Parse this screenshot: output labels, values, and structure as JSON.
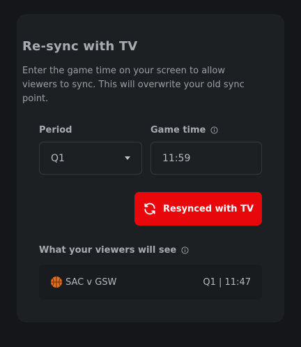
{
  "card": {
    "title": "Re-sync with TV",
    "description": "Enter the game time on your screen to allow viewers to sync. This will overwrite your old sync point."
  },
  "form": {
    "period_label": "Period",
    "period_value": "Q1",
    "game_time_label": "Game time",
    "game_time_value": "11:59"
  },
  "button": {
    "label": "Resynced with TV",
    "icon": "refresh-icon",
    "color": "#e8080b"
  },
  "preview": {
    "label": "What your viewers will see",
    "matchup": "SAC v GSW",
    "team_icon": "basketball-icon",
    "status": "Q1 | 11:47"
  }
}
